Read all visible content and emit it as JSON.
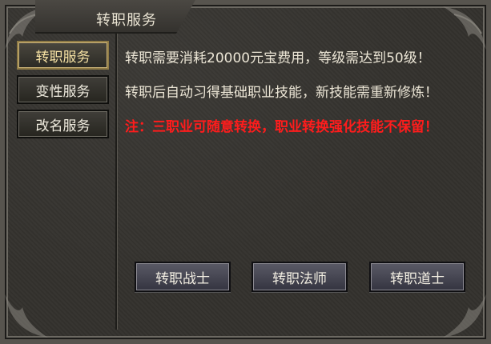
{
  "window": {
    "title": "转职服务"
  },
  "sidebar": {
    "items": [
      {
        "label": "转职服务",
        "active": true
      },
      {
        "label": "变性服务",
        "active": false
      },
      {
        "label": "改名服务",
        "active": false
      }
    ]
  },
  "content": {
    "lines": [
      {
        "text": "转职需要消耗20000元宝费用，等级需达到50级！",
        "color": "#ece6d6"
      },
      {
        "text": "转职后自动习得基础职业技能，新技能需重新修炼！",
        "color": "#ece6d6"
      },
      {
        "text": "注：三职业可随意转换，职业转换强化技能不保留！",
        "color": "#ff1c1c"
      }
    ]
  },
  "actions": {
    "warrior": "转职战士",
    "mage": "转职法师",
    "taoist": "转职道士"
  }
}
